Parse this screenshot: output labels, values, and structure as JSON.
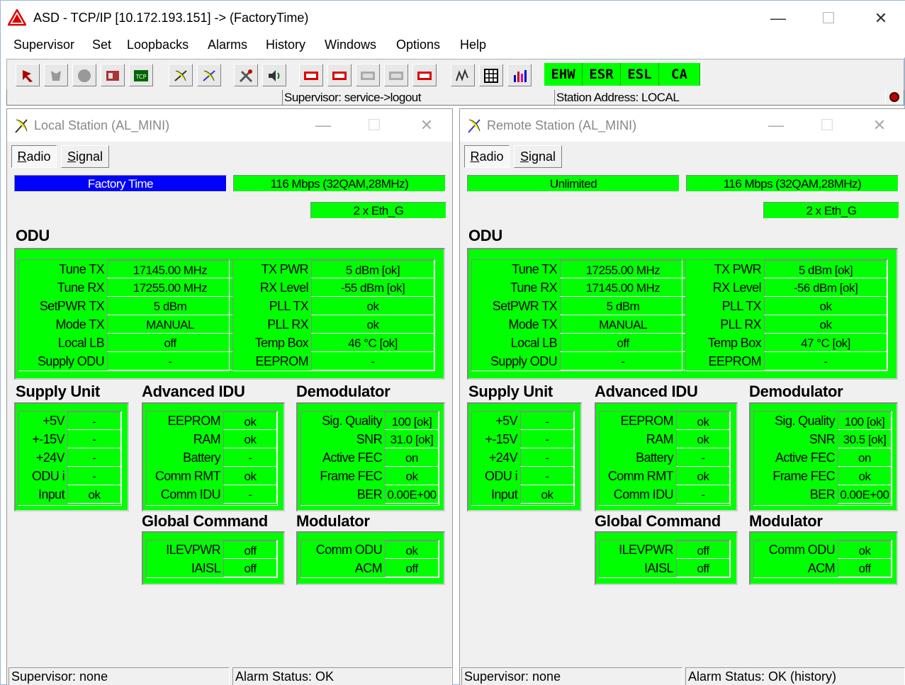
{
  "window": {
    "title": "ASD - TCP/IP [10.172.193.151] -> (FactoryTime)",
    "controls": {
      "minimize": "—",
      "maximize": "☐",
      "close": "✕"
    }
  },
  "menu": [
    "Supervisor",
    "Set",
    "Loopbacks",
    "Alarms",
    "History",
    "Windows",
    "Options",
    "Help"
  ],
  "toolbar": {
    "icons": [
      "supervisor-icon",
      "history-icon",
      "stop-icon",
      "equipment-icon",
      "tcp-icon",
      "antenna-icon",
      "antenna-alt-icon",
      "tools-icon",
      "speaker-icon",
      "loopback-1-icon",
      "loopback-2-icon",
      "loopback-3-icon",
      "loopback-4-icon",
      "loopback-5-icon",
      "measure-icon",
      "grid-icon",
      "chart-icon"
    ],
    "tcp_label": "TCP",
    "alarm_indicators": [
      "EHW",
      "ESR",
      "ESL",
      "CA"
    ],
    "alarm_color": "#00ff00"
  },
  "status": {
    "supervisor": "Supervisor: service->logout",
    "station_address": "Station Address: LOCAL"
  },
  "local": {
    "title": "Local Station (AL_MINI)",
    "tabs": [
      "Radio",
      "Signal"
    ],
    "mode": "Factory Time",
    "capacity": "116 Mbps (32QAM,28MHz)",
    "interface": "2 x Eth_G",
    "odu_title": "ODU",
    "odu_left": [
      {
        "label": "Tune TX",
        "value": "17145.00 MHz"
      },
      {
        "label": "Tune RX",
        "value": "17255.00 MHz"
      },
      {
        "label": "SetPWR TX",
        "value": "5 dBm"
      },
      {
        "label": "Mode TX",
        "value": "MANUAL"
      },
      {
        "label": "Local LB",
        "value": "off"
      },
      {
        "label": "Supply ODU",
        "value": "-"
      }
    ],
    "odu_right": [
      {
        "label": "TX PWR",
        "value": "5 dBm [ok]"
      },
      {
        "label": "RX Level",
        "value": "-55 dBm [ok]"
      },
      {
        "label": "PLL TX",
        "value": "ok"
      },
      {
        "label": "PLL RX",
        "value": "ok"
      },
      {
        "label": "Temp Box",
        "value": "46 °C [ok]"
      },
      {
        "label": "EEPROM",
        "value": "-"
      }
    ],
    "supply_title": "Supply Unit",
    "supply": [
      {
        "label": "+5V",
        "value": "-"
      },
      {
        "label": "+-15V",
        "value": "-"
      },
      {
        "label": "+24V",
        "value": "-"
      },
      {
        "label": "ODU  i",
        "value": "-"
      },
      {
        "label": "Input",
        "value": "ok"
      }
    ],
    "adv_title": "Advanced IDU",
    "adv": [
      {
        "label": "EEPROM",
        "value": "ok"
      },
      {
        "label": "RAM",
        "value": "ok"
      },
      {
        "label": "Battery",
        "value": "-"
      },
      {
        "label": "Comm RMT",
        "value": "ok"
      },
      {
        "label": "Comm IDU",
        "value": "-"
      }
    ],
    "demod_title": "Demodulator",
    "demod": [
      {
        "label": "Sig. Quality",
        "value": "100 [ok]"
      },
      {
        "label": "SNR",
        "value": "31.0 [ok]"
      },
      {
        "label": "Active FEC",
        "value": "on"
      },
      {
        "label": "Frame FEC",
        "value": "ok"
      },
      {
        "label": "BER",
        "value": "0.00E+00"
      }
    ],
    "global_title": "Global Command",
    "global": [
      {
        "label": "ILEVPWR",
        "value": "off"
      },
      {
        "label": "IAISL",
        "value": "off"
      }
    ],
    "mod_title": "Modulator",
    "mod": [
      {
        "label": "Comm ODU",
        "value": "ok"
      },
      {
        "label": "ACM",
        "value": "off"
      }
    ],
    "status_supervisor": "Supervisor: none",
    "status_alarm": "Alarm Status: OK"
  },
  "remote": {
    "title": "Remote Station (AL_MINI)",
    "tabs": [
      "Radio",
      "Signal"
    ],
    "mode": "Unlimited",
    "capacity": "116 Mbps (32QAM,28MHz)",
    "interface": "2 x Eth_G",
    "odu_title": "ODU",
    "odu_left": [
      {
        "label": "Tune TX",
        "value": "17255.00 MHz"
      },
      {
        "label": "Tune RX",
        "value": "17145.00 MHz"
      },
      {
        "label": "SetPWR TX",
        "value": "5 dBm"
      },
      {
        "label": "Mode TX",
        "value": "MANUAL"
      },
      {
        "label": "Local LB",
        "value": "off"
      },
      {
        "label": "Supply ODU",
        "value": "-"
      }
    ],
    "odu_right": [
      {
        "label": "TX PWR",
        "value": "5 dBm [ok]"
      },
      {
        "label": "RX Level",
        "value": "-56 dBm [ok]"
      },
      {
        "label": "PLL TX",
        "value": "ok"
      },
      {
        "label": "PLL RX",
        "value": "ok"
      },
      {
        "label": "Temp Box",
        "value": "47 °C [ok]"
      },
      {
        "label": "EEPROM",
        "value": "-"
      }
    ],
    "supply_title": "Supply Unit",
    "supply": [
      {
        "label": "+5V",
        "value": "-"
      },
      {
        "label": "+-15V",
        "value": "-"
      },
      {
        "label": "+24V",
        "value": "-"
      },
      {
        "label": "ODU  i",
        "value": "-"
      },
      {
        "label": "Input",
        "value": "ok"
      }
    ],
    "adv_title": "Advanced IDU",
    "adv": [
      {
        "label": "EEPROM",
        "value": "ok"
      },
      {
        "label": "RAM",
        "value": "ok"
      },
      {
        "label": "Battery",
        "value": "-"
      },
      {
        "label": "Comm RMT",
        "value": "ok"
      },
      {
        "label": "Comm IDU",
        "value": "-"
      }
    ],
    "demod_title": "Demodulator",
    "demod": [
      {
        "label": "Sig. Quality",
        "value": "100 [ok]"
      },
      {
        "label": "SNR",
        "value": "30.5 [ok]"
      },
      {
        "label": "Active FEC",
        "value": "on"
      },
      {
        "label": "Frame FEC",
        "value": "ok"
      },
      {
        "label": "BER",
        "value": "0.00E+00"
      }
    ],
    "global_title": "Global Command",
    "global": [
      {
        "label": "ILEVPWR",
        "value": "off"
      },
      {
        "label": "IAISL",
        "value": "off"
      }
    ],
    "mod_title": "Modulator",
    "mod": [
      {
        "label": "Comm ODU",
        "value": "ok"
      },
      {
        "label": "ACM",
        "value": "off"
      }
    ],
    "status_supervisor": "Supervisor: none",
    "status_alarm": "Alarm Status: OK (history)"
  }
}
